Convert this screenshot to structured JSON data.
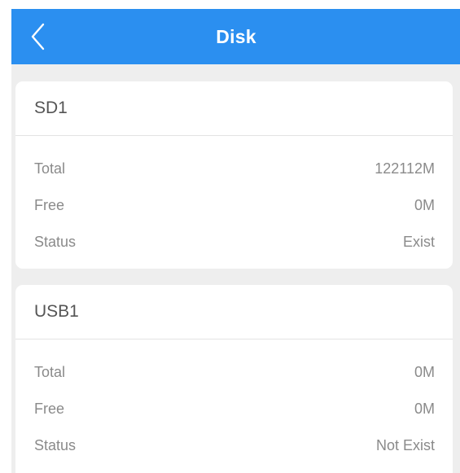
{
  "header": {
    "title": "Disk",
    "bg_color": "#2b8ff0"
  },
  "disks": [
    {
      "name": "SD1",
      "rows": [
        {
          "label": "Total",
          "value": "122112M"
        },
        {
          "label": "Free",
          "value": "0M"
        },
        {
          "label": "Status",
          "value": "Exist"
        }
      ]
    },
    {
      "name": "USB1",
      "rows": [
        {
          "label": "Total",
          "value": "0M"
        },
        {
          "label": "Free",
          "value": "0M"
        },
        {
          "label": "Status",
          "value": "Not Exist"
        }
      ]
    }
  ],
  "icons": {
    "back": "chevron-left-icon"
  }
}
